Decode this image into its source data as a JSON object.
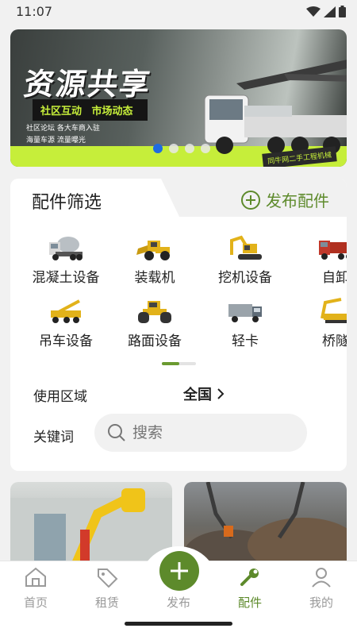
{
  "status_bar": {
    "time": "11:07"
  },
  "banner": {
    "title": "资源共享",
    "subtitle_items": [
      "社区互动",
      "市场动态"
    ],
    "small_lines": [
      "社区论坛  各大车商入驻",
      "海量车源  流量曝光"
    ],
    "tag": "同牛网二手工程机械",
    "slide_count": 4,
    "active_slide": 1
  },
  "filter": {
    "title": "配件筛选",
    "publish_label": "发布配件",
    "categories": [
      {
        "label": "混凝土设备",
        "icon": "concrete-mixer-icon"
      },
      {
        "label": "装载机",
        "icon": "loader-icon"
      },
      {
        "label": "挖机设备",
        "icon": "excavator-icon"
      },
      {
        "label": "自卸",
        "icon": "dump-truck-icon"
      },
      {
        "label": "吊车设备",
        "icon": "crane-icon"
      },
      {
        "label": "路面设备",
        "icon": "road-roller-icon"
      },
      {
        "label": "轻卡",
        "icon": "light-truck-icon"
      },
      {
        "label": "桥隧",
        "icon": "bridge-tunnel-icon"
      }
    ],
    "region_label": "使用区域",
    "region_value": "全国",
    "keyword_label": "关键词",
    "search_placeholder": "搜索"
  },
  "bottom_nav": {
    "items": [
      {
        "label": "首页",
        "icon": "home-icon"
      },
      {
        "label": "租赁",
        "icon": "tag-icon"
      },
      {
        "label": "发布",
        "icon": "plus-icon"
      },
      {
        "label": "配件",
        "icon": "wrench-icon"
      },
      {
        "label": "我的",
        "icon": "person-icon"
      }
    ],
    "active": "配件"
  },
  "colors": {
    "accent": "#5d8a2b",
    "banner_green": "#c6ee3a",
    "dot_active": "#1f6be0"
  }
}
